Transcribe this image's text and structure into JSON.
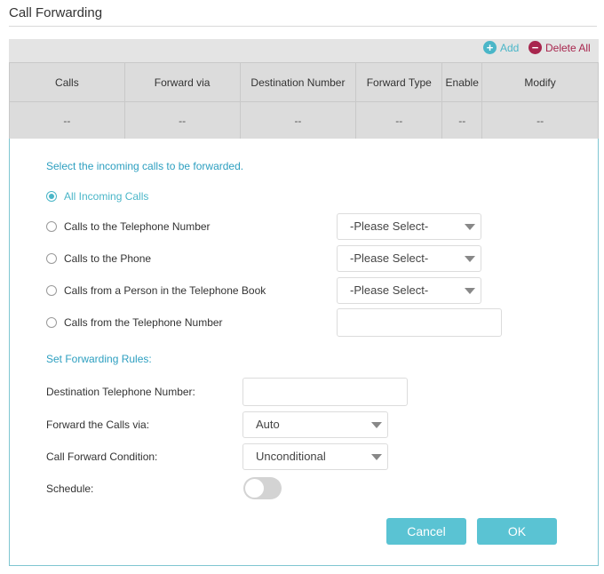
{
  "page": {
    "title": "Call Forwarding"
  },
  "toolbar": {
    "add_label": "Add",
    "add_icon": "plus-circle-icon",
    "delete_all_label": "Delete All",
    "delete_icon": "minus-circle-icon"
  },
  "table": {
    "columns": [
      "Calls",
      "Forward via",
      "Destination Number",
      "Forward Type",
      "Enable",
      "Modify"
    ],
    "rows": [
      [
        "--",
        "--",
        "--",
        "--",
        "--",
        "--"
      ]
    ]
  },
  "form": {
    "incoming_heading": "Select the incoming calls to be forwarded.",
    "options": [
      {
        "label": "All Incoming Calls",
        "selected": true
      },
      {
        "label": "Calls to the Telephone Number",
        "select_value": "-Please Select-"
      },
      {
        "label": "Calls to the Phone",
        "select_value": "-Please Select-"
      },
      {
        "label": "Calls from a Person in the Telephone Book",
        "select_value": "-Please Select-"
      },
      {
        "label": "Calls from the Telephone Number",
        "input_value": ""
      }
    ],
    "rules_heading": "Set Forwarding Rules:",
    "destination_label": "Destination Telephone Number:",
    "destination_value": "",
    "via_label": "Forward the Calls via:",
    "via_value": "Auto",
    "condition_label": "Call Forward Condition:",
    "condition_value": "Unconditional",
    "schedule_label": "Schedule:",
    "schedule_enabled": false,
    "cancel_label": "Cancel",
    "ok_label": "OK"
  },
  "colors": {
    "accent": "#4ab6c8",
    "danger": "#a8264e",
    "button": "#5ac3d3"
  }
}
